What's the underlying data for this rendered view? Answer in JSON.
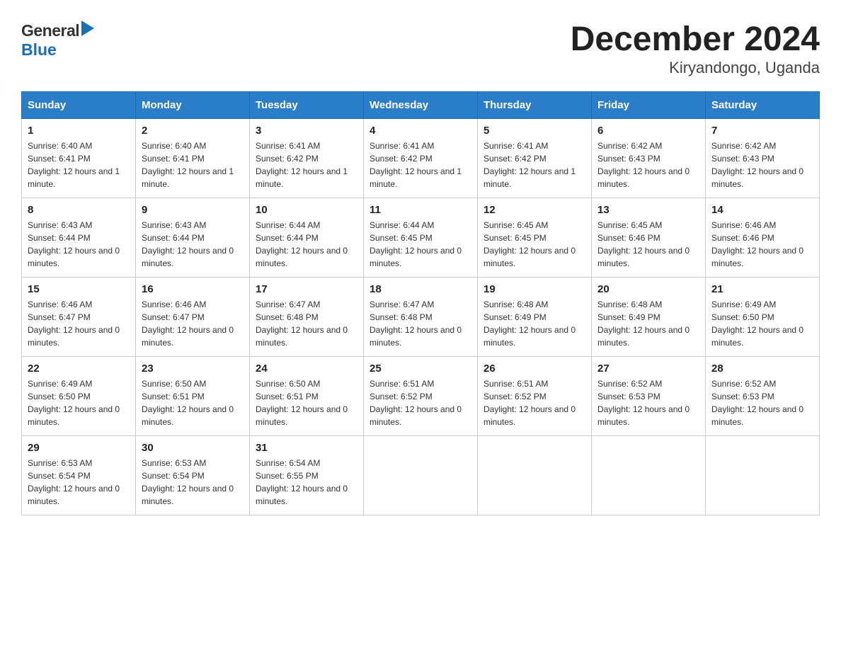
{
  "header": {
    "logo_general": "General",
    "logo_blue": "Blue",
    "title": "December 2024",
    "subtitle": "Kiryandongo, Uganda"
  },
  "calendar": {
    "days": [
      "Sunday",
      "Monday",
      "Tuesday",
      "Wednesday",
      "Thursday",
      "Friday",
      "Saturday"
    ],
    "weeks": [
      [
        {
          "num": "1",
          "sunrise": "6:40 AM",
          "sunset": "6:41 PM",
          "daylight": "12 hours and 1 minute."
        },
        {
          "num": "2",
          "sunrise": "6:40 AM",
          "sunset": "6:41 PM",
          "daylight": "12 hours and 1 minute."
        },
        {
          "num": "3",
          "sunrise": "6:41 AM",
          "sunset": "6:42 PM",
          "daylight": "12 hours and 1 minute."
        },
        {
          "num": "4",
          "sunrise": "6:41 AM",
          "sunset": "6:42 PM",
          "daylight": "12 hours and 1 minute."
        },
        {
          "num": "5",
          "sunrise": "6:41 AM",
          "sunset": "6:42 PM",
          "daylight": "12 hours and 1 minute."
        },
        {
          "num": "6",
          "sunrise": "6:42 AM",
          "sunset": "6:43 PM",
          "daylight": "12 hours and 0 minutes."
        },
        {
          "num": "7",
          "sunrise": "6:42 AM",
          "sunset": "6:43 PM",
          "daylight": "12 hours and 0 minutes."
        }
      ],
      [
        {
          "num": "8",
          "sunrise": "6:43 AM",
          "sunset": "6:44 PM",
          "daylight": "12 hours and 0 minutes."
        },
        {
          "num": "9",
          "sunrise": "6:43 AM",
          "sunset": "6:44 PM",
          "daylight": "12 hours and 0 minutes."
        },
        {
          "num": "10",
          "sunrise": "6:44 AM",
          "sunset": "6:44 PM",
          "daylight": "12 hours and 0 minutes."
        },
        {
          "num": "11",
          "sunrise": "6:44 AM",
          "sunset": "6:45 PM",
          "daylight": "12 hours and 0 minutes."
        },
        {
          "num": "12",
          "sunrise": "6:45 AM",
          "sunset": "6:45 PM",
          "daylight": "12 hours and 0 minutes."
        },
        {
          "num": "13",
          "sunrise": "6:45 AM",
          "sunset": "6:46 PM",
          "daylight": "12 hours and 0 minutes."
        },
        {
          "num": "14",
          "sunrise": "6:46 AM",
          "sunset": "6:46 PM",
          "daylight": "12 hours and 0 minutes."
        }
      ],
      [
        {
          "num": "15",
          "sunrise": "6:46 AM",
          "sunset": "6:47 PM",
          "daylight": "12 hours and 0 minutes."
        },
        {
          "num": "16",
          "sunrise": "6:46 AM",
          "sunset": "6:47 PM",
          "daylight": "12 hours and 0 minutes."
        },
        {
          "num": "17",
          "sunrise": "6:47 AM",
          "sunset": "6:48 PM",
          "daylight": "12 hours and 0 minutes."
        },
        {
          "num": "18",
          "sunrise": "6:47 AM",
          "sunset": "6:48 PM",
          "daylight": "12 hours and 0 minutes."
        },
        {
          "num": "19",
          "sunrise": "6:48 AM",
          "sunset": "6:49 PM",
          "daylight": "12 hours and 0 minutes."
        },
        {
          "num": "20",
          "sunrise": "6:48 AM",
          "sunset": "6:49 PM",
          "daylight": "12 hours and 0 minutes."
        },
        {
          "num": "21",
          "sunrise": "6:49 AM",
          "sunset": "6:50 PM",
          "daylight": "12 hours and 0 minutes."
        }
      ],
      [
        {
          "num": "22",
          "sunrise": "6:49 AM",
          "sunset": "6:50 PM",
          "daylight": "12 hours and 0 minutes."
        },
        {
          "num": "23",
          "sunrise": "6:50 AM",
          "sunset": "6:51 PM",
          "daylight": "12 hours and 0 minutes."
        },
        {
          "num": "24",
          "sunrise": "6:50 AM",
          "sunset": "6:51 PM",
          "daylight": "12 hours and 0 minutes."
        },
        {
          "num": "25",
          "sunrise": "6:51 AM",
          "sunset": "6:52 PM",
          "daylight": "12 hours and 0 minutes."
        },
        {
          "num": "26",
          "sunrise": "6:51 AM",
          "sunset": "6:52 PM",
          "daylight": "12 hours and 0 minutes."
        },
        {
          "num": "27",
          "sunrise": "6:52 AM",
          "sunset": "6:53 PM",
          "daylight": "12 hours and 0 minutes."
        },
        {
          "num": "28",
          "sunrise": "6:52 AM",
          "sunset": "6:53 PM",
          "daylight": "12 hours and 0 minutes."
        }
      ],
      [
        {
          "num": "29",
          "sunrise": "6:53 AM",
          "sunset": "6:54 PM",
          "daylight": "12 hours and 0 minutes."
        },
        {
          "num": "30",
          "sunrise": "6:53 AM",
          "sunset": "6:54 PM",
          "daylight": "12 hours and 0 minutes."
        },
        {
          "num": "31",
          "sunrise": "6:54 AM",
          "sunset": "6:55 PM",
          "daylight": "12 hours and 0 minutes."
        },
        null,
        null,
        null,
        null
      ]
    ]
  }
}
